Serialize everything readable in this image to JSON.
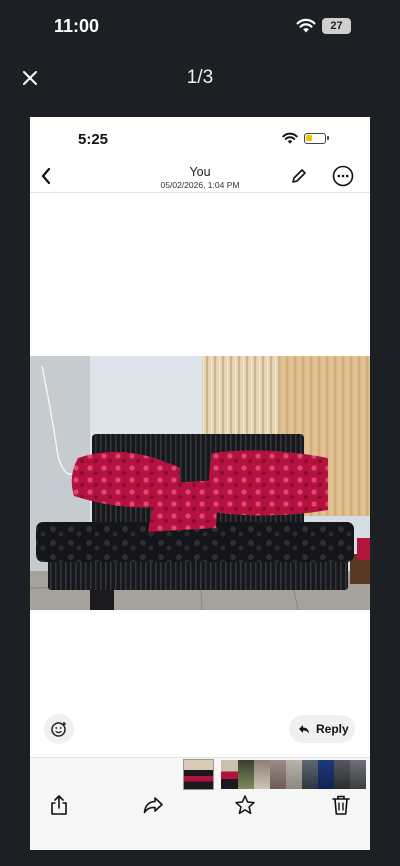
{
  "status_bar": {
    "time": "11:00",
    "battery": "27"
  },
  "viewer": {
    "counter": "1/3"
  },
  "inner_status": {
    "time": "5:25"
  },
  "message_header": {
    "sender": "You",
    "date": "05/02/2026, 1:04 PM"
  },
  "message": {
    "reply_label": "Reply"
  },
  "icons": [
    "close-icon",
    "wifi-icon",
    "chevron-left-icon",
    "pencil-icon",
    "ellipsis-circle-icon",
    "smiley-add-icon",
    "reply-arrow-icon",
    "share-icon",
    "forward-icon",
    "star-icon",
    "trash-icon"
  ],
  "colors": {
    "viewer_bg": "#1c1f24",
    "battery_low": "#f2c400"
  }
}
